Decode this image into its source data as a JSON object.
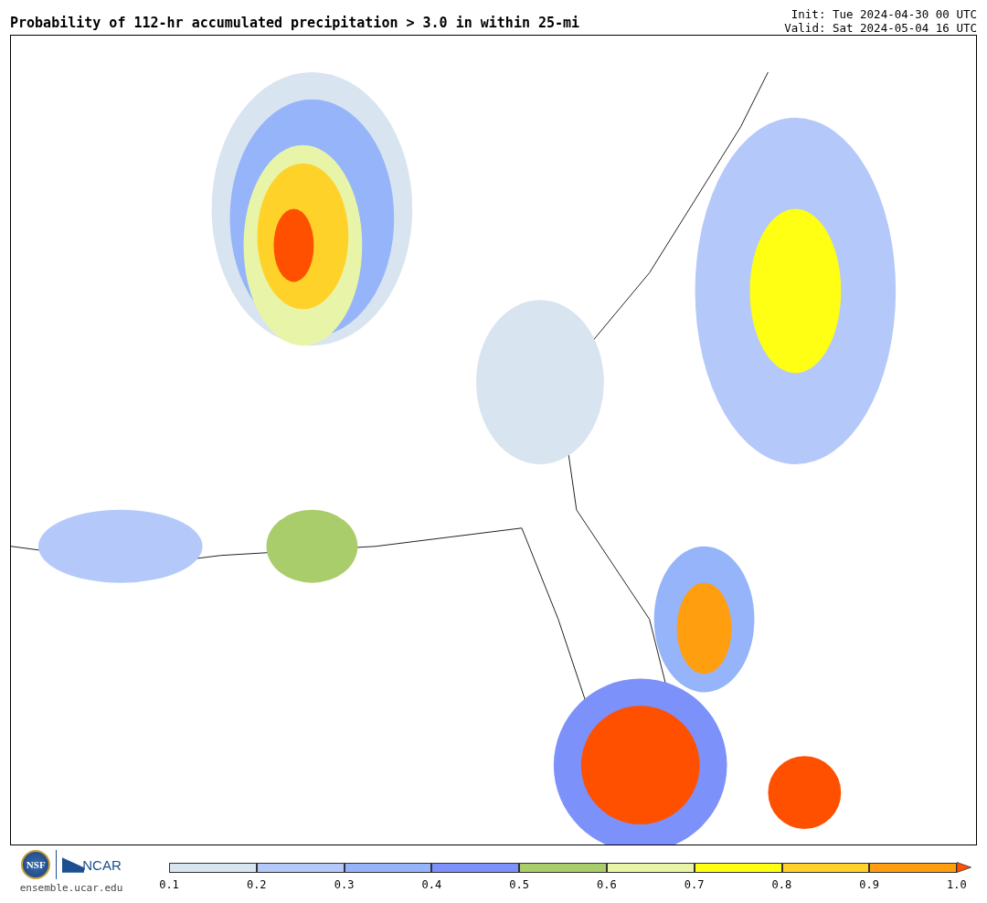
{
  "title": "Probability of 112-hr accumulated precipitation > 3.0 in within 25-mi",
  "init": "Init: Tue 2024-04-30 00 UTC",
  "valid": "Valid: Sat 2024-05-04 16 UTC",
  "logos": {
    "nsf": "NSF",
    "ncar": "NCAR",
    "site": "ensemble.ucar.edu"
  },
  "colorbar": {
    "segments": [
      {
        "color": "#d8e4ef"
      },
      {
        "color": "#b4c8fa"
      },
      {
        "color": "#96b4fa"
      },
      {
        "color": "#7d91fa"
      },
      {
        "color": "#a8cd6a"
      },
      {
        "color": "#e8f5a8"
      },
      {
        "color": "#ffff14"
      },
      {
        "color": "#ffd22a"
      },
      {
        "color": "#ff9e0f"
      }
    ],
    "extension": {
      "color": "#ff5000"
    },
    "ticks": [
      "0.1",
      "0.2",
      "0.3",
      "0.4",
      "0.5",
      "0.6",
      "0.7",
      "0.8",
      "0.9",
      "1.0"
    ]
  }
}
